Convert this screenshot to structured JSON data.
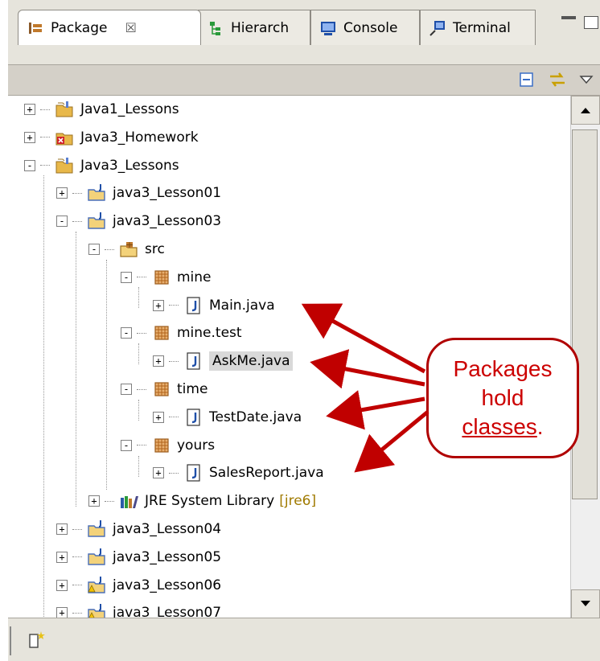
{
  "tabs": [
    {
      "label": "Package",
      "close": "☒",
      "icon": "package-explorer-icon"
    },
    {
      "label": "Hierarch",
      "icon": "hierarchy-icon"
    },
    {
      "label": "Console",
      "icon": "console-icon"
    },
    {
      "label": "Terminal",
      "icon": "terminal-icon"
    }
  ],
  "tree": [
    {
      "label": "Java1_Lessons",
      "toggle": "+",
      "icon": "project-icon"
    },
    {
      "label": "Java3_Homework",
      "toggle": "+",
      "icon": "project-error-icon"
    },
    {
      "label": "Java3_Lessons",
      "toggle": "-",
      "icon": "project-icon"
    },
    {
      "label": "java3_Lesson01",
      "toggle": "+",
      "icon": "java-project-icon"
    },
    {
      "label": "java3_Lesson03",
      "toggle": "-",
      "icon": "java-project-icon"
    },
    {
      "label": "src",
      "toggle": "-",
      "icon": "source-folder-icon"
    },
    {
      "label": "mine",
      "toggle": "-",
      "icon": "package-icon"
    },
    {
      "label": "Main.java",
      "toggle": "+",
      "icon": "java-file-icon"
    },
    {
      "label": "mine.test",
      "toggle": "-",
      "icon": "package-icon"
    },
    {
      "label": "AskMe.java",
      "toggle": "+",
      "icon": "java-file-icon",
      "selected": true
    },
    {
      "label": "time",
      "toggle": "-",
      "icon": "package-icon"
    },
    {
      "label": "TestDate.java",
      "toggle": "+",
      "icon": "java-file-icon"
    },
    {
      "label": "yours",
      "toggle": "-",
      "icon": "package-icon"
    },
    {
      "label": "SalesReport.java",
      "toggle": "+",
      "icon": "java-file-icon"
    },
    {
      "label": "JRE System Library",
      "decoration": "[jre6]",
      "toggle": "+",
      "icon": "library-icon"
    },
    {
      "label": "java3_Lesson04",
      "toggle": "+",
      "icon": "java-project-icon"
    },
    {
      "label": "java3_Lesson05",
      "toggle": "+",
      "icon": "java-project-icon"
    },
    {
      "label": "java3_Lesson06",
      "toggle": "+",
      "icon": "java-project-warning-icon"
    },
    {
      "label": "java3_Lesson07",
      "toggle": "+",
      "icon": "java-project-warning-icon"
    }
  ],
  "callout": {
    "line1": "Packages",
    "line2": "hold",
    "line3": "classes",
    "period": "."
  },
  "colors": {
    "callout": "#cc0000",
    "arrow": "#c00000",
    "folder": "#e8b84a",
    "package": "#c0792c"
  }
}
